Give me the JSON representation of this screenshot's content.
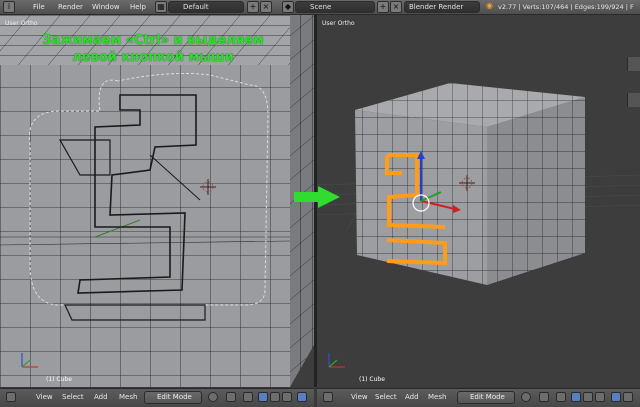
{
  "top_bar": {
    "menu": [
      "File",
      "Render",
      "Window",
      "Help"
    ],
    "layout_name": "Default",
    "scene_name": "Scene",
    "render_engine": "Blender Render",
    "status": "v2.77 | Verts:107/464 | Edges:199/924 | F"
  },
  "left_viewport": {
    "label": "User Ortho",
    "object_label": "(1) Cube",
    "caption_line1": "Зажимаем «Ctrl» и выделяем",
    "caption_line2": "левой кнопкой мыши"
  },
  "right_viewport": {
    "label": "User Ortho",
    "object_label": "(1) Cube"
  },
  "header": {
    "menu": [
      "View",
      "Select",
      "Add",
      "Mesh"
    ],
    "mode": "Edit Mode"
  },
  "colors": {
    "caption": "#2fdc2f",
    "selection": "#ff9c1a",
    "face": "#9a9ca0",
    "edge": "#1a1a1a",
    "accent": "#5680c2"
  }
}
